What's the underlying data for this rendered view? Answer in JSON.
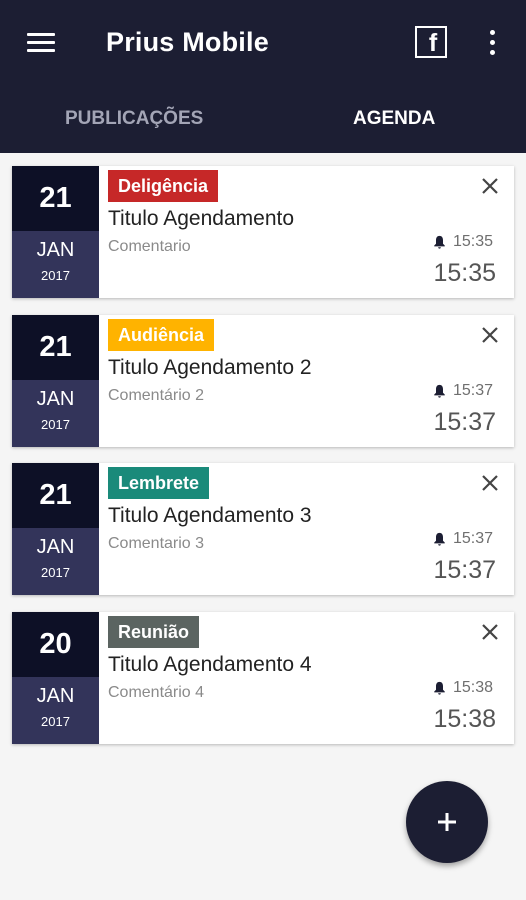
{
  "app": {
    "title": "Prius Mobile"
  },
  "tabs": [
    {
      "label": "PUBLICAÇÕES",
      "active": false
    },
    {
      "label": "AGENDA",
      "active": true
    }
  ],
  "icons": {
    "menu": "menu-icon",
    "facebook": "facebook-icon",
    "more": "more-vert-icon",
    "add": "plus-icon",
    "close": "close-icon",
    "alarm": "bell-icon"
  },
  "colors": {
    "appbar": "#1c1e33",
    "deligencia": "#c62828",
    "audiencia": "#ffb300",
    "lembrete": "#1a8a7a",
    "reuniao": "#5b6461"
  },
  "events": [
    {
      "day": "21",
      "month": "JAN",
      "year": "2017",
      "tag": "Deligência",
      "tag_color": "#c62828",
      "title": "Titulo Agendamento",
      "comment": "Comentario",
      "alarm": "15:35",
      "time": "15:35"
    },
    {
      "day": "21",
      "month": "JAN",
      "year": "2017",
      "tag": "Audiência",
      "tag_color": "#ffb300",
      "title": "Titulo Agendamento 2",
      "comment": "Comentário 2",
      "alarm": "15:37",
      "time": "15:37"
    },
    {
      "day": "21",
      "month": "JAN",
      "year": "2017",
      "tag": "Lembrete",
      "tag_color": "#1a8a7a",
      "title": "Titulo Agendamento 3",
      "comment": "Comentario 3",
      "alarm": "15:37",
      "time": "15:37"
    },
    {
      "day": "20",
      "month": "JAN",
      "year": "2017",
      "tag": "Reunião",
      "tag_color": "#5b6461",
      "title": "Titulo Agendamento 4",
      "comment": "Comentário 4",
      "alarm": "15:38",
      "time": "15:38"
    }
  ]
}
